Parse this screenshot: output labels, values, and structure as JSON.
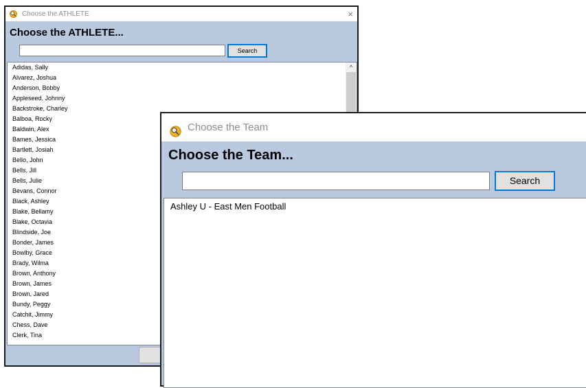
{
  "athlete_window": {
    "title": "Choose the ATHLETE",
    "heading": "Choose the ATHLETE...",
    "search_value": "",
    "search_button": "Search",
    "close_glyph": "×",
    "items": [
      "Adidas, Sally",
      "Alvarez, Joshua",
      "Anderson, Bobby",
      "Appleseed, Johnny",
      "Backstroke, Charley",
      "Balboa, Rocky",
      "Baldwin, Alex",
      "Bames, Jessica",
      "Bartlett, Josiah",
      "Bello, John",
      "Bells, Jill",
      "Bells, Julie",
      "Bevans, Connor",
      "Black, Ashley",
      "Blake, Bellamy",
      "Blake, Octavia",
      "Blindside, Joe",
      "Bonder, James",
      "Bowlby, Grace",
      "Brady, Wilma",
      "Brown, Anthony",
      "Brown, James",
      "Brown, Jared",
      "Bundy, Peggy",
      "Catchit, Jimmy",
      "Chess, Dave",
      "Clerk, Tina"
    ],
    "scroll_up_glyph": "^",
    "icons": {
      "app": "magnifier-app-icon",
      "close": "close-icon"
    }
  },
  "team_window": {
    "title": "Choose the Team",
    "heading": "Choose the Team...",
    "search_value": "",
    "search_button": "Search",
    "items": [
      "Ashley U -  East Men Football"
    ],
    "icons": {
      "app": "magnifier-app-icon"
    }
  },
  "colors": {
    "window_bg": "#b9c9e0",
    "title_text": "#8c8c8c",
    "focus_border": "#0078d7",
    "button_bg": "#e1e1e1"
  }
}
